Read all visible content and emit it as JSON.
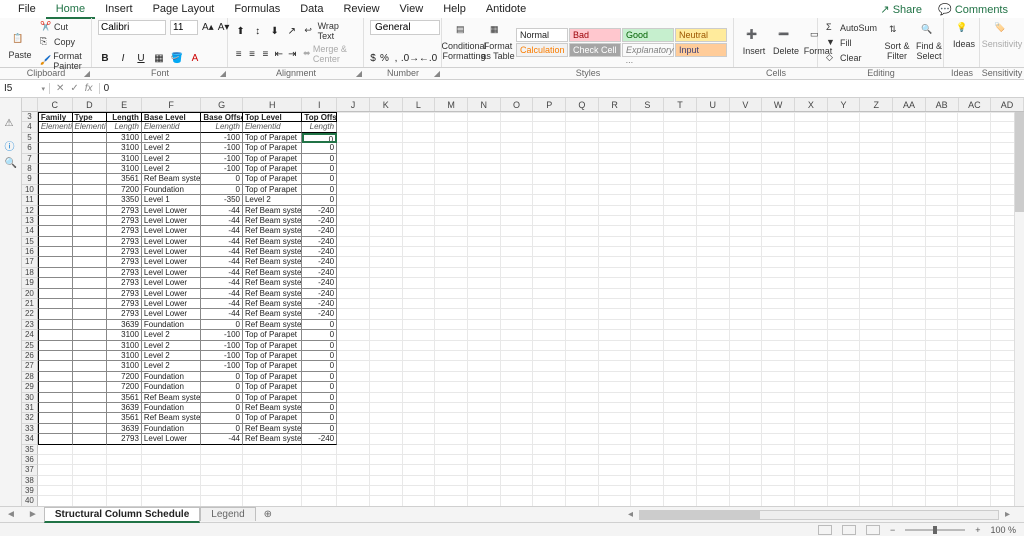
{
  "menu": {
    "items": [
      "File",
      "Home",
      "Insert",
      "Page Layout",
      "Formulas",
      "Data",
      "Review",
      "View",
      "Help",
      "Antidote"
    ],
    "active_index": 1,
    "share": "Share",
    "comments": "Comments"
  },
  "ribbon": {
    "paste": "Paste",
    "cut": "Cut",
    "copy": "Copy",
    "format_painter": "Format Painter",
    "font_name": "Calibri",
    "font_size": "11",
    "wrap_text": "Wrap Text",
    "merge_center": "Merge & Center",
    "number_format": "General",
    "cond_fmt": "Conditional Formatting",
    "fmt_table": "Format as Table",
    "styles": {
      "normal": "Normal",
      "bad": "Bad",
      "good": "Good",
      "neutral": "Neutral",
      "calculation": "Calculation",
      "check_cell": "Check Cell",
      "explanatory": "Explanatory ...",
      "input": "Input"
    },
    "insert": "Insert",
    "delete": "Delete",
    "format": "Format",
    "autosum": "AutoSum",
    "fill": "Fill",
    "clear": "Clear",
    "sort_filter": "Sort & Filter",
    "find_select": "Find & Select",
    "ideas": "Ideas",
    "sensitivity": "Sensitivity",
    "groups": [
      "Clipboard",
      "Font",
      "Alignment",
      "Number",
      "Styles",
      "Cells",
      "Editing",
      "Ideas",
      "Sensitivity"
    ]
  },
  "formula_bar": {
    "cell_ref": "I5",
    "fx": "fx",
    "value": "0"
  },
  "sheet": {
    "cols": [
      "C",
      "D",
      "E",
      "F",
      "G",
      "H",
      "I",
      "J",
      "K",
      "L",
      "M",
      "N",
      "O",
      "P",
      "Q",
      "R",
      "S",
      "T",
      "U",
      "V",
      "W",
      "X",
      "Y",
      "Z",
      "AA",
      "AB",
      "AC",
      "AD"
    ],
    "header_row_num": 3,
    "subheader_row_num": 4,
    "headers": [
      "Family",
      "Type",
      "Length",
      "Base Level",
      "Base Offset",
      "Top Level",
      "Top Offset"
    ],
    "subheaders": [
      "Elementid",
      "Elementid",
      "Length",
      "Elementid",
      "Length",
      "Elementid",
      "Length"
    ],
    "data_start_row": 5,
    "rows": [
      {
        "length": 3100,
        "base": "Level 2",
        "off": -100,
        "top": "Top of Parapet",
        "toff": 0
      },
      {
        "length": 3100,
        "base": "Level 2",
        "off": -100,
        "top": "Top of Parapet",
        "toff": 0
      },
      {
        "length": 3100,
        "base": "Level 2",
        "off": -100,
        "top": "Top of Parapet",
        "toff": 0
      },
      {
        "length": 3100,
        "base": "Level 2",
        "off": -100,
        "top": "Top of Parapet",
        "toff": 0
      },
      {
        "length": 3561,
        "base": "Ref Beam system",
        "off": 0,
        "top": "Top of Parapet",
        "toff": 0
      },
      {
        "length": 7200,
        "base": "Foundation",
        "off": 0,
        "top": "Top of Parapet",
        "toff": 0
      },
      {
        "length": 3350,
        "base": "Level 1",
        "off": -350,
        "top": "Level 2",
        "toff": 0
      },
      {
        "length": 2793,
        "base": "Level Lower",
        "off": -44,
        "top": "Ref Beam system",
        "toff": -240
      },
      {
        "length": 2793,
        "base": "Level Lower",
        "off": -44,
        "top": "Ref Beam system",
        "toff": -240
      },
      {
        "length": 2793,
        "base": "Level Lower",
        "off": -44,
        "top": "Ref Beam system",
        "toff": -240
      },
      {
        "length": 2793,
        "base": "Level Lower",
        "off": -44,
        "top": "Ref Beam system",
        "toff": -240
      },
      {
        "length": 2793,
        "base": "Level Lower",
        "off": -44,
        "top": "Ref Beam system",
        "toff": -240
      },
      {
        "length": 2793,
        "base": "Level Lower",
        "off": -44,
        "top": "Ref Beam system",
        "toff": -240
      },
      {
        "length": 2793,
        "base": "Level Lower",
        "off": -44,
        "top": "Ref Beam system",
        "toff": -240
      },
      {
        "length": 2793,
        "base": "Level Lower",
        "off": -44,
        "top": "Ref Beam system",
        "toff": -240
      },
      {
        "length": 2793,
        "base": "Level Lower",
        "off": -44,
        "top": "Ref Beam system",
        "toff": -240
      },
      {
        "length": 2793,
        "base": "Level Lower",
        "off": -44,
        "top": "Ref Beam system",
        "toff": -240
      },
      {
        "length": 2793,
        "base": "Level Lower",
        "off": -44,
        "top": "Ref Beam system",
        "toff": -240
      },
      {
        "length": 3639,
        "base": "Foundation",
        "off": 0,
        "top": "Ref Beam system",
        "toff": 0
      },
      {
        "length": 3100,
        "base": "Level 2",
        "off": -100,
        "top": "Top of Parapet",
        "toff": 0
      },
      {
        "length": 3100,
        "base": "Level 2",
        "off": -100,
        "top": "Top of Parapet",
        "toff": 0
      },
      {
        "length": 3100,
        "base": "Level 2",
        "off": -100,
        "top": "Top of Parapet",
        "toff": 0
      },
      {
        "length": 3100,
        "base": "Level 2",
        "off": -100,
        "top": "Top of Parapet",
        "toff": 0
      },
      {
        "length": 7200,
        "base": "Foundation",
        "off": 0,
        "top": "Top of Parapet",
        "toff": 0
      },
      {
        "length": 7200,
        "base": "Foundation",
        "off": 0,
        "top": "Top of Parapet",
        "toff": 0
      },
      {
        "length": 3561,
        "base": "Ref Beam system",
        "off": 0,
        "top": "Top of Parapet",
        "toff": 0
      },
      {
        "length": 3639,
        "base": "Foundation",
        "off": 0,
        "top": "Ref Beam system",
        "toff": 0
      },
      {
        "length": 3561,
        "base": "Ref Beam system",
        "off": 0,
        "top": "Top of Parapet",
        "toff": 0
      },
      {
        "length": 3639,
        "base": "Foundation",
        "off": 0,
        "top": "Ref Beam system",
        "toff": 0
      },
      {
        "length": 2793,
        "base": "Level Lower",
        "off": -44,
        "top": "Ref Beam system",
        "toff": -240
      }
    ],
    "empty_rows": [
      35,
      36,
      37,
      38,
      39,
      40
    ]
  },
  "tabs": {
    "items": [
      "Structural Column Schedule",
      "Legend"
    ],
    "active_index": 0
  },
  "status": {
    "zoom": "100 %"
  }
}
